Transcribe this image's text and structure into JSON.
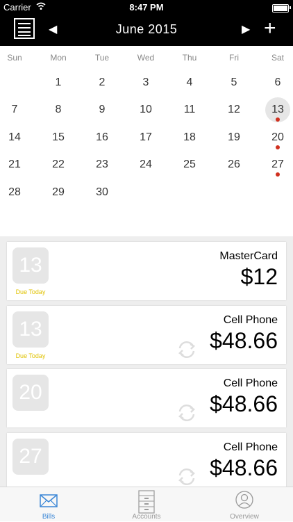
{
  "status_bar": {
    "carrier": "Carrier",
    "time": "8:47 PM"
  },
  "nav": {
    "month_label": "June 2015",
    "prev_glyph": "◀",
    "next_glyph": "▶",
    "add_glyph": "+"
  },
  "calendar": {
    "weekdays": [
      "Sun",
      "Mon",
      "Tue",
      "Wed",
      "Thu",
      "Fri",
      "Sat"
    ],
    "weeks": [
      [
        "",
        "1",
        "2",
        "3",
        "4",
        "5",
        "6"
      ],
      [
        "7",
        "8",
        "9",
        "10",
        "11",
        "12",
        "13"
      ],
      [
        "14",
        "15",
        "16",
        "17",
        "18",
        "19",
        "20"
      ],
      [
        "21",
        "22",
        "23",
        "24",
        "25",
        "26",
        "27"
      ],
      [
        "28",
        "29",
        "30",
        "",
        "",
        "",
        ""
      ]
    ],
    "selected_day": "13",
    "bill_days": [
      "13",
      "20",
      "27"
    ],
    "dot_color": "#d0301f",
    "selected_color": "#e6e6e6"
  },
  "bills": [
    {
      "day": "13",
      "due_label": "Due Today",
      "name": "MasterCard",
      "amount": "$12",
      "recurring": false
    },
    {
      "day": "13",
      "due_label": "Due Today",
      "name": "Cell Phone",
      "amount": "$48.66",
      "recurring": true
    },
    {
      "day": "20",
      "due_label": "",
      "name": "Cell Phone",
      "amount": "$48.66",
      "recurring": true
    },
    {
      "day": "27",
      "due_label": "",
      "name": "Cell Phone",
      "amount": "$48.66",
      "recurring": true
    }
  ],
  "due_color": "#e0c200",
  "tabs": [
    {
      "label": "Bills",
      "icon": "envelope-icon",
      "active": true
    },
    {
      "label": "Accounts",
      "icon": "drawer-cabinet-icon",
      "active": false
    },
    {
      "label": "Overview",
      "icon": "user-circle-icon",
      "active": false
    }
  ],
  "accent_color": "#3a86d6"
}
